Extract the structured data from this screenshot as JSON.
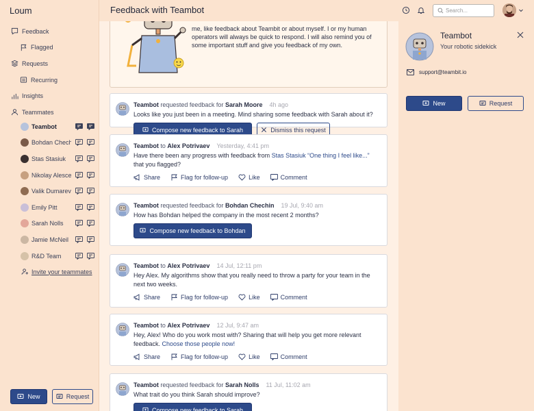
{
  "app": {
    "brand": "Loum",
    "page_title": "Feedback with Teambot"
  },
  "search": {
    "placeholder": "Search..."
  },
  "nav": [
    {
      "label": "Feedback",
      "icon": "feedback-icon"
    },
    {
      "label": "Flagged",
      "icon": "flag-icon",
      "sub": true
    },
    {
      "label": "Requests",
      "icon": "stack-icon"
    },
    {
      "label": "Recurring",
      "icon": "recurring-icon",
      "sub": true
    },
    {
      "label": "Insights",
      "icon": "bar-chart-icon"
    },
    {
      "label": "Teammates",
      "icon": "people-icon"
    }
  ],
  "teammates": [
    {
      "name": "Teambot",
      "active": true,
      "color": "#b7c3dc"
    },
    {
      "name": "Bohdan Chechin",
      "color": "#7a5a48"
    },
    {
      "name": "Stas Stasiuk",
      "color": "#3a3030"
    },
    {
      "name": "Nikolay Alescenko",
      "color": "#c7a080"
    },
    {
      "name": "Valik Dumarevich",
      "color": "#8f6c52"
    },
    {
      "name": "Emily Pitt",
      "color": "#c9bfd8"
    },
    {
      "name": "Sarah Nolls",
      "color": "#e3a79a"
    },
    {
      "name": "Jamie McNeil",
      "color": "#cbb7a3"
    },
    {
      "name": "R&D Team",
      "color": "#d6c2a8"
    }
  ],
  "invite_label": "Invite your teammates",
  "buttons": {
    "new": "New",
    "request": "Request"
  },
  "intro_text": "me, like feedback about Teambit or about myself. I or my human operators will always be quick to respond. I will also remind you of some important stuff and give you feedback of my own.",
  "feed": [
    {
      "from": "Teambot",
      "verb": "requested feedback for",
      "to": "Sarah Moore",
      "time": "4h ago",
      "message": "Looks like you just been in a meeting. Mind sharing some feedback with Sarah about it?",
      "actions": [
        "Compose new feedback to Sarah",
        "Dismiss this request"
      ]
    },
    {
      "from": "Teambot",
      "verb": "to",
      "to": "Alex Potrivaev",
      "time": "Yesterday, 4:41 pm",
      "message_parts": [
        "Have there been any progress with feedback from ",
        "Stas Stasiuk “One thing I feel like...”",
        " that you flagged?"
      ],
      "reactions": [
        "Share",
        "Flag for follow-up",
        "Like",
        "Comment"
      ]
    },
    {
      "from": "Teambot",
      "verb": "requested feedback for",
      "to": "Bohdan Chechin",
      "time": "19 Jul, 9:40 am",
      "message": "How has Bohdan helped the company in the most recent 2 months?",
      "actions": [
        "Compose new feedback to Bohdan"
      ]
    },
    {
      "from": "Teambot",
      "verb": "to",
      "to": "Alex Potrivaev",
      "time": "14 Jul, 12:11 pm",
      "message": "Hey Alex. My algorithms show that you really need to throw a party for your team in the next two weeks.",
      "reactions": [
        "Share",
        "Flag for follow-up",
        "Like",
        "Comment"
      ]
    },
    {
      "from": "Teambot",
      "verb": "to",
      "to": "Alex Potrivaev",
      "time": "12 Jul, 9:47 am",
      "message_parts": [
        "Hey, Alex! Who do you work most with? Sharing that will help you get more relevant feedback. ",
        "Choose those people now!",
        ""
      ],
      "reactions": [
        "Share",
        "Flag for follow-up",
        "Like",
        "Comment"
      ]
    },
    {
      "from": "Teambot",
      "verb": "requested feedback for",
      "to": "Sarah Nolls",
      "time": "11 Jul, 11:02 am",
      "message": "What trait do you think Sarah should improve?",
      "actions": [
        "Compose new feedback to Sarah"
      ]
    }
  ],
  "profile": {
    "name": "Teambot",
    "subtitle": "Your robotic sidekick",
    "email": "support@teambit.io"
  },
  "colors": {
    "primary": "#2d4a8a",
    "sidebar_bg": "#fbe3cf",
    "feed_bg": "#fef0e4"
  }
}
